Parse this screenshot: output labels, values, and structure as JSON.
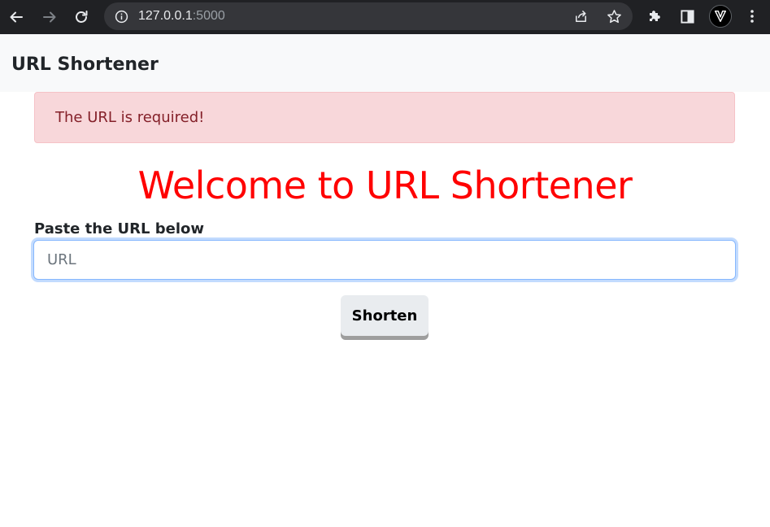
{
  "browser": {
    "url_host": "127.0.0.1",
    "url_port": ":5000",
    "icons": {
      "back": "back-arrow-icon",
      "forward": "forward-arrow-icon",
      "reload": "reload-icon",
      "info": "info-icon",
      "share": "share-icon",
      "bookmark": "star-icon",
      "extensions": "puzzle-icon",
      "side_panel": "side-panel-icon",
      "menu": "kebab-menu-icon"
    },
    "colors": {
      "chrome_bg": "#202124",
      "omnibox_bg": "#35363a"
    }
  },
  "navbar": {
    "brand": "URL Shortener",
    "background": "#f8f9fa"
  },
  "alert": {
    "message": "The URL is required!",
    "background": "#f8d7da",
    "text_color": "#842029"
  },
  "main": {
    "heading": "Welcome to URL Shortener",
    "heading_color": "#ff0000",
    "form": {
      "label": "Paste the URL below",
      "input_placeholder": "URL",
      "input_value": "",
      "submit_label": "Shorten"
    }
  }
}
